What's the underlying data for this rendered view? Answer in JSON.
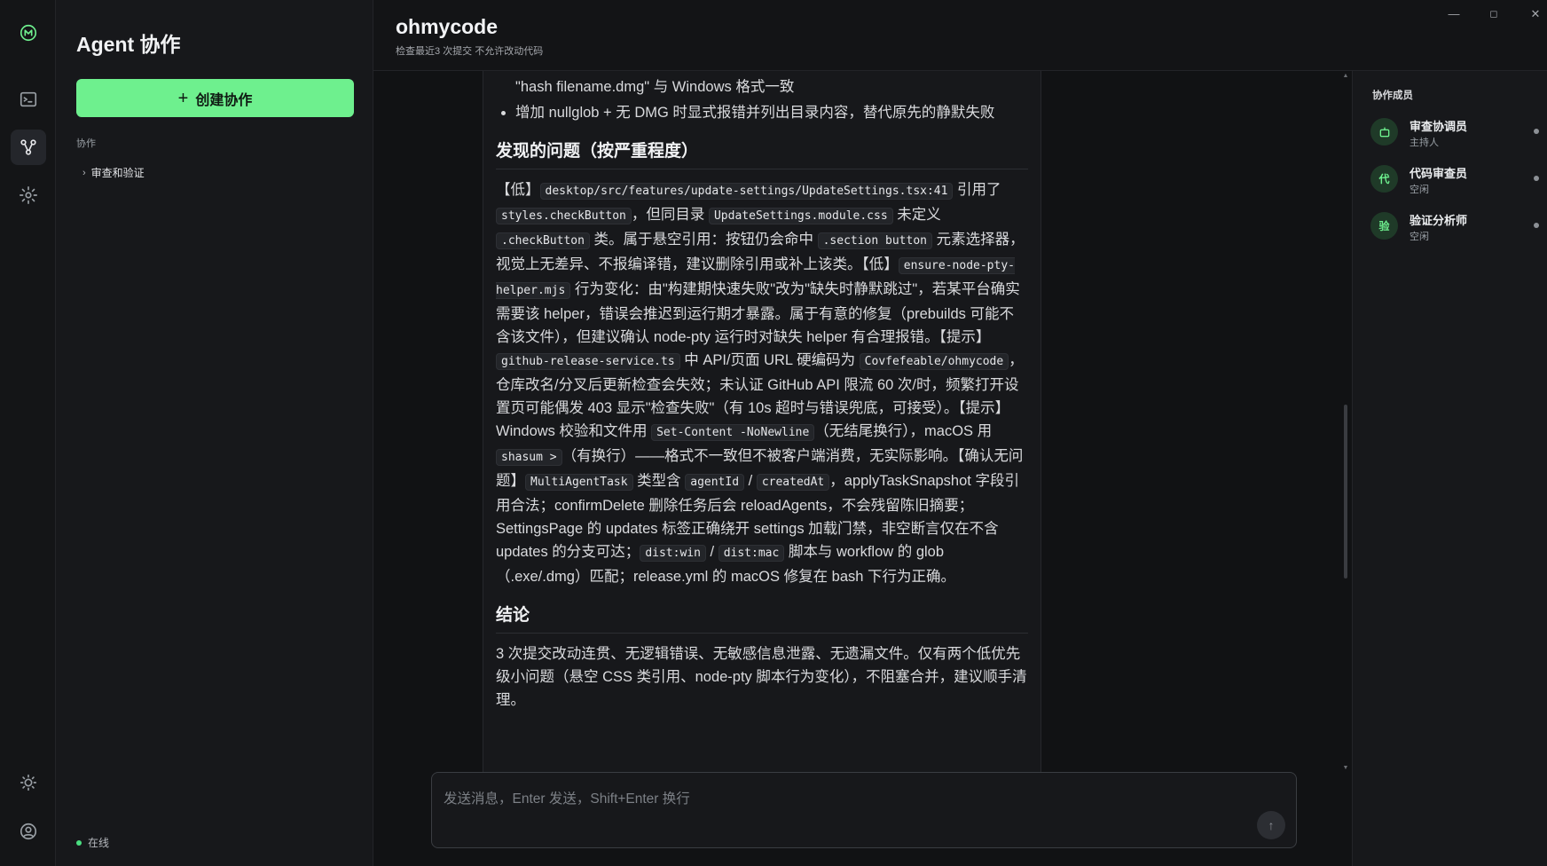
{
  "app": {
    "title": "ohmycode",
    "subtitle": "检查最近3 次提交 不允许改动代码",
    "window_controls": {
      "minimize": "—",
      "maximize": "◻",
      "close": "✕"
    }
  },
  "rail": {
    "icons": [
      "logo-icon",
      "terminal-icon",
      "agent-network-icon",
      "settings-icon",
      "theme-icon",
      "account-icon"
    ]
  },
  "sidebar": {
    "title": "Agent 协作",
    "create_button": "创建协作",
    "create_icon": "+",
    "section_label": "协作",
    "items": [
      {
        "label": "审查和验证",
        "chevron": "›"
      }
    ],
    "status": "在线"
  },
  "message": {
    "bullets": [
      "校验和命令由 sed 改路径改为 cd 进目录后对 basename 执行 shasum，输出 \"hash filename.dmg\" 与 Windows 格式一致",
      "增加 nullglob + 无 DMG 时显式报错并列出目录内容，替代原先的静默失败"
    ],
    "issues_heading": "发现的问题（按严重程度）",
    "issues": {
      "t1": "【低】",
      "c1": "desktop/src/features/update-settings/UpdateSettings.tsx:41",
      "t2": " 引用了 ",
      "c2": "styles.checkButton",
      "t3": "，但同目录 ",
      "c3": "UpdateSettings.module.css",
      "t4": " 未定义 ",
      "c4": ".checkButton",
      "t5": " 类。属于悬空引用：按钮仍会命中 ",
      "c5": ".section button",
      "t6": " 元素选择器，视觉上无差异、不报编译错，建议删除引用或补上该类。【低】",
      "c6": "ensure-node-pty-helper.mjs",
      "t7": " 行为变化：由\"构建期快速失败\"改为\"缺失时静默跳过\"，若某平台确实需要该 helper，错误会推迟到运行期才暴露。属于有意的修复（prebuilds 可能不含该文件），但建议确认 node-pty 运行时对缺失 helper 有合理报错。【提示】",
      "c7": "github-release-service.ts",
      "t8": " 中 API/页面 URL 硬编码为 ",
      "c8": "Covfefeable/ohmycode",
      "t9": "，仓库改名/分叉后更新检查会失效；未认证 GitHub API 限流 60 次/时，频繁打开设置页可能偶发 403 显示\"检查失败\"（有 10s 超时与错误兜底，可接受）。【提示】Windows 校验和文件用 ",
      "c9": "Set-Content -NoNewline",
      "t10": "（无结尾换行），macOS 用 ",
      "c10": "shasum >",
      "t11": "（有换行）——格式不一致但不被客户端消费，无实际影响。【确认无问题】",
      "c11": "MultiAgentTask",
      "t12": " 类型含 ",
      "c12": "agentId",
      "t13": " / ",
      "c13": "createdAt",
      "t14": "，applyTaskSnapshot 字段引用合法；confirmDelete 删除任务后会 reloadAgents，不会残留陈旧摘要；SettingsPage 的 updates 标签正确绕开 settings 加载门禁，非空断言仅在不含 updates 的分支可达；",
      "c14": "dist:win",
      "t15": " / ",
      "c15": "dist:mac",
      "t16": " 脚本与 workflow 的 glob（.exe/.dmg）匹配；release.yml 的 macOS 修复在 bash 下行为正确。"
    },
    "conclusion_heading": "结论",
    "conclusion": "3 次提交改动连贯、无逻辑错误、无敏感信息泄露、无遗漏文件。仅有两个低优先级小问题（悬空 CSS 类引用、node-pty 脚本行为变化），不阻塞合并，建议顺手清理。"
  },
  "composer": {
    "placeholder": "发送消息，Enter 发送，Shift+Enter 换行",
    "send_icon": "↑"
  },
  "members": {
    "title": "协作成员",
    "list": [
      {
        "avatar": "robot-icon",
        "name": "审查协调员",
        "role": "主持人"
      },
      {
        "avatar": "代",
        "name": "代码审查员",
        "role": "空闲"
      },
      {
        "avatar": "验",
        "name": "验证分析师",
        "role": "空闲"
      }
    ]
  },
  "colors": {
    "accent": "#6ef08e",
    "online": "#4ade80",
    "background": "#111214"
  }
}
